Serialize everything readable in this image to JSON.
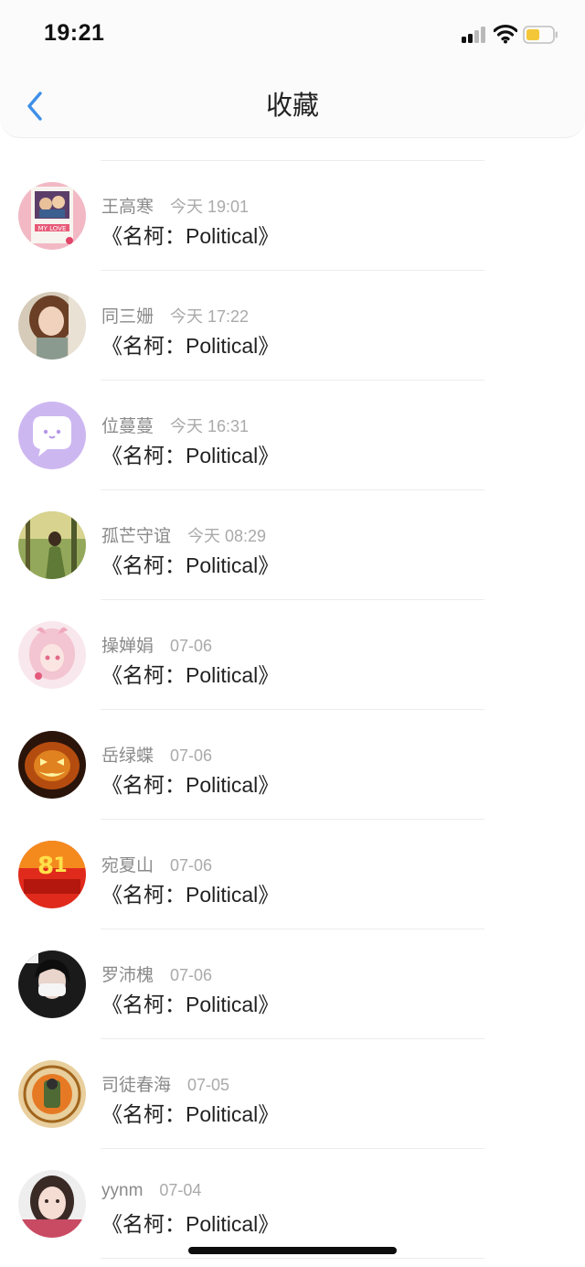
{
  "status_bar": {
    "time": "19:21"
  },
  "nav": {
    "title": "收藏",
    "back_icon": "chevron-left-icon",
    "accent_color": "#3d8fe8"
  },
  "items": [
    {
      "name": "王高寒",
      "date": "今天 19:01",
      "title": "《名柯：Political》",
      "avatar": "my-love-sticker"
    },
    {
      "name": "同三姗",
      "date": "今天 17:22",
      "title": "《名柯：Political》",
      "avatar": "girl-photo"
    },
    {
      "name": "位蔓蔓",
      "date": "今天 16:31",
      "title": "《名柯：Political》",
      "avatar": "chat-bubble-face"
    },
    {
      "name": "孤芒守谊",
      "date": "今天 08:29",
      "title": "《名柯：Political》",
      "avatar": "forest-girl"
    },
    {
      "name": "操婵娟",
      "date": "07-06",
      "title": "《名柯：Political》",
      "avatar": "anime-girl"
    },
    {
      "name": "岳绿蝶",
      "date": "07-06",
      "title": "《名柯：Political》",
      "avatar": "pumpkin-lantern"
    },
    {
      "name": "宛夏山",
      "date": "07-06",
      "title": "《名柯：Political》",
      "avatar": "car-festival-badge"
    },
    {
      "name": "罗沛槐",
      "date": "07-06",
      "title": "《名柯：Political》",
      "avatar": "masked-person"
    },
    {
      "name": "司徒春海",
      "date": "07-05",
      "title": "《名柯：Political》",
      "avatar": "emblem-badge"
    },
    {
      "name": "yynm",
      "date": "07-04",
      "title": "《名柯：Political》",
      "avatar": "girl-portrait"
    }
  ]
}
